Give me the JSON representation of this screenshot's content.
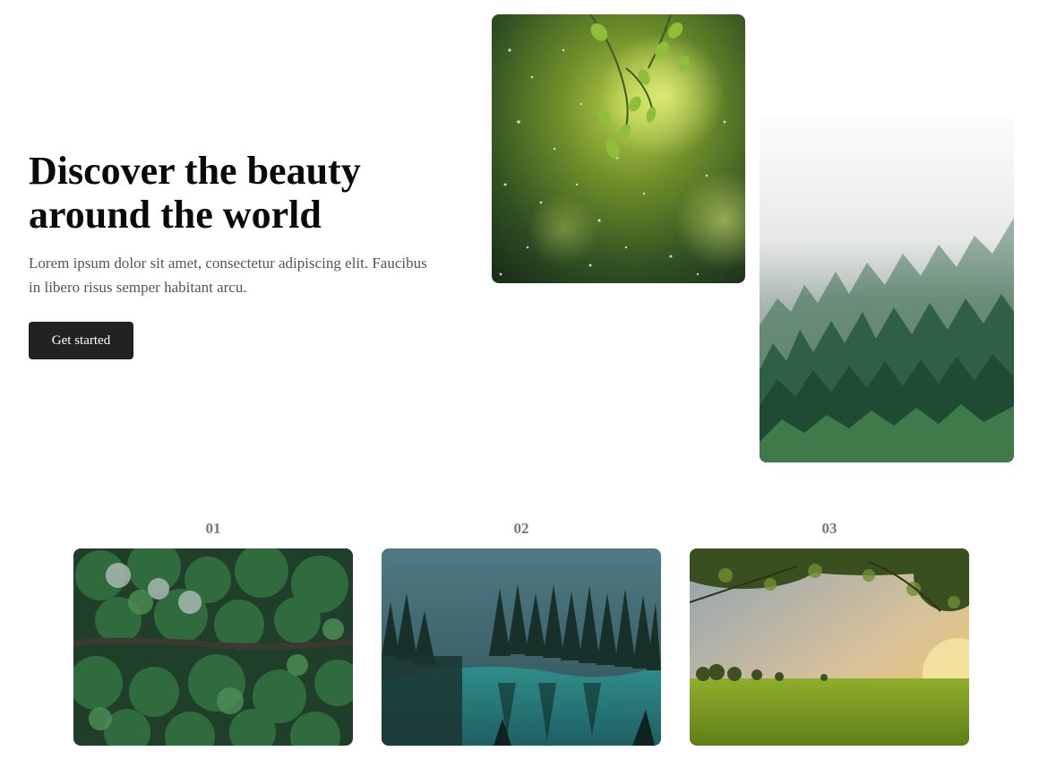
{
  "hero": {
    "title": "Discover the beauty around the world",
    "subtitle": "Lorem ipsum dolor sit amet, consectetur adipiscing elit. Faucibus in libero risus semper habitant arcu.",
    "cta_label": "Get started"
  },
  "gallery": {
    "items": [
      {
        "number": "01"
      },
      {
        "number": "02"
      },
      {
        "number": "03"
      }
    ]
  },
  "colors": {
    "button_bg": "#222222",
    "button_text": "#ffffff",
    "body_text": "#555555",
    "number_text": "#777777"
  }
}
